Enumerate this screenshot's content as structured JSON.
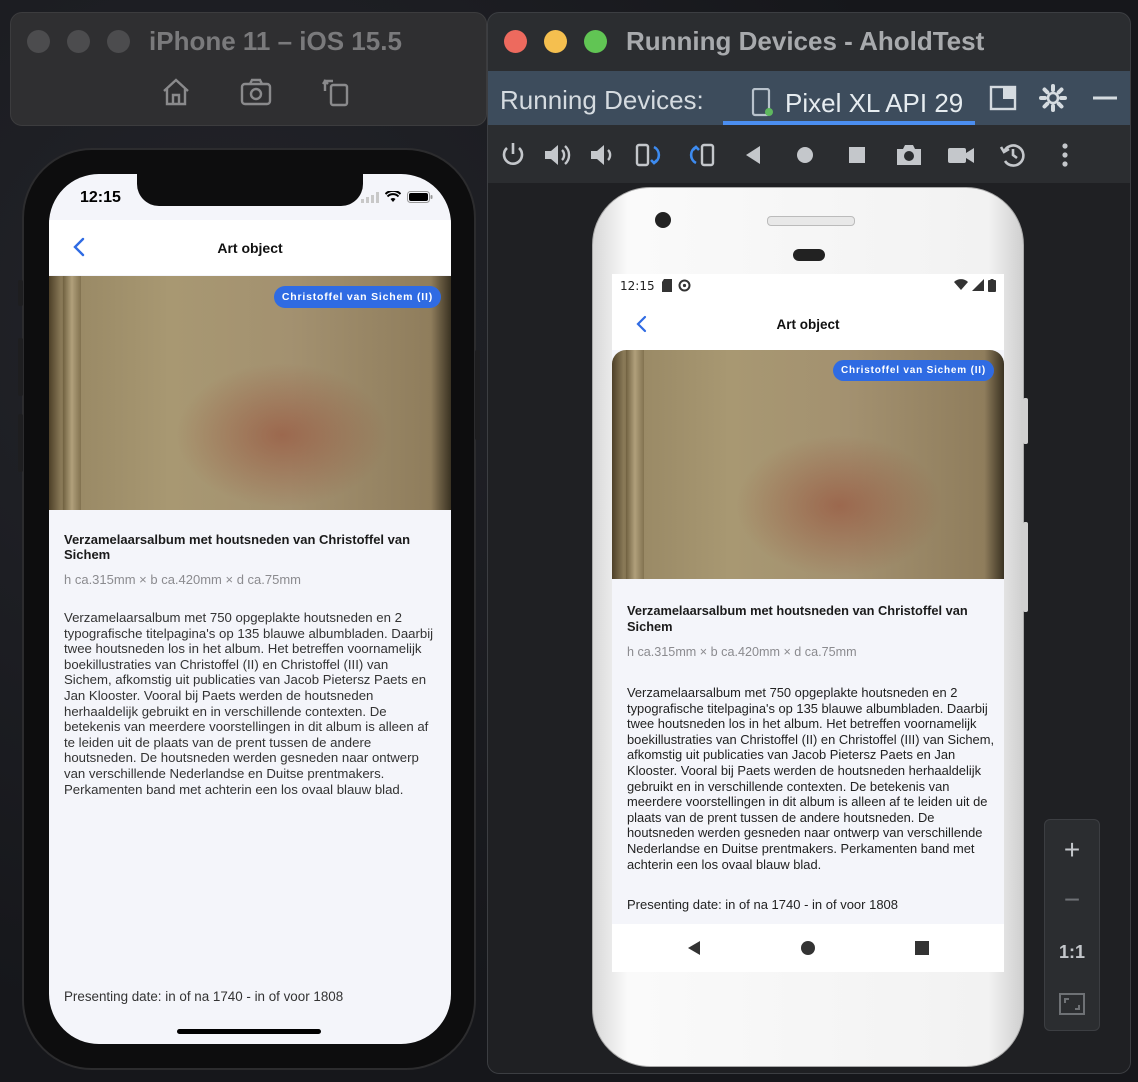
{
  "ios_window": {
    "title": "iPhone 11 – iOS 15.5",
    "toolbar_icons": [
      "home-icon",
      "screenshot-icon",
      "rotate-icon"
    ]
  },
  "ios_app": {
    "time": "12:15",
    "nav_title": "Art object",
    "tag": "Christoffel van Sichem (II)",
    "title": "Verzamelaarsalbum met houtsneden van Christoffel van Sichem",
    "dimensions": "h ca.315mm × b ca.420mm × d ca.75mm",
    "description": "Verzamelaarsalbum met 750 opgeplakte houtsneden en 2 typografische titelpagina's op 135 blauwe albumbladen. Daarbij twee houtsneden los in het album. Het betreffen voornamelijk boekillustraties van Christoffel (II) en Christoffel (III) van Sichem, afkomstig uit publicaties van Jacob Pietersz Paets en Jan Klooster. Vooral bij Paets werden de houtsneden herhaaldelijk gebruikt en in verschillende contexten. De betekenis van meerdere voorstellingen in dit album is alleen af te leiden uit de plaats van de prent tussen de andere houtsneden. De houtsneden werden gesneden naar ontwerp van verschillende Nederlandse en Duitse prentmakers. Perkamenten band met achterin een los ovaal blauw blad.",
    "presenting_date": "Presenting date: in of na 1740 - in of voor 1808"
  },
  "as_window": {
    "title": "Running Devices - AholdTest",
    "tabs_label": "Running Devices:",
    "device_tab": "Pixel XL API 29",
    "accent": "#4b8ef0",
    "toolbar_icons": [
      "power-icon",
      "volume-up-icon",
      "volume-down-icon",
      "rotate-left-icon",
      "rotate-right-icon",
      "back-icon",
      "home-icon",
      "overview-icon",
      "camera-icon",
      "record-icon",
      "restore-icon",
      "more-icon"
    ],
    "zoom": {
      "plus": "+",
      "minus": "−",
      "one_to_one": "1:1"
    }
  },
  "android_app": {
    "time": "12:15",
    "nav_title": "Art object",
    "tag": "Christoffel van Sichem (II)",
    "title": "Verzamelaarsalbum met houtsneden van Christoffel van Sichem",
    "dimensions": "h ca.315mm × b ca.420mm × d ca.75mm",
    "description": "Verzamelaarsalbum met 750 opgeplakte houtsneden en 2 typografische titelpagina's op 135 blauwe albumbladen. Daarbij twee houtsneden los in het album. Het betreffen voornamelijk boekillustraties van Christoffel (II) en Christoffel (III) van Sichem, afkomstig uit publicaties van Jacob Pietersz Paets en Jan Klooster. Vooral bij Paets werden de houtsneden herhaaldelijk gebruikt en in verschillende contexten. De betekenis van meerdere voorstellingen in dit album is alleen af te leiden uit de plaats van de prent tussen de andere houtsneden. De houtsneden werden gesneden naar ontwerp van verschillende Nederlandse en Duitse prentmakers. Perkamenten band met achterin een los ovaal blauw blad.",
    "presenting_date": "Presenting date: in of na 1740 - in of voor 1808"
  }
}
